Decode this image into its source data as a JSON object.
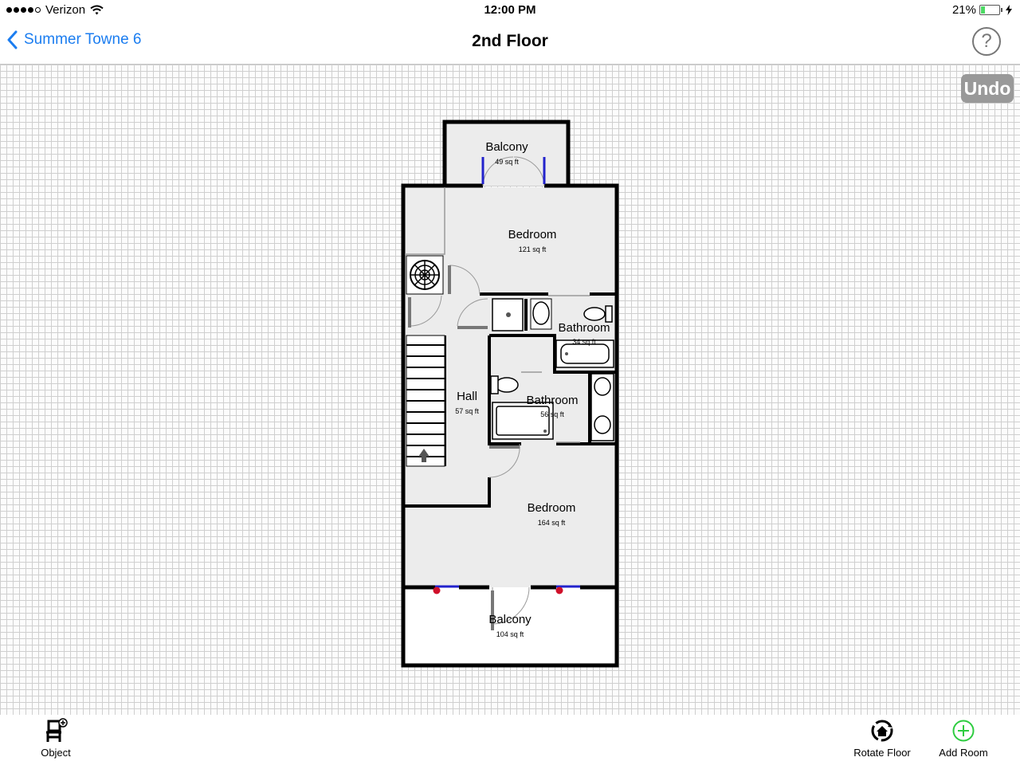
{
  "status_bar": {
    "carrier": "Verizon",
    "time": "12:00 PM",
    "battery_percent": "21%",
    "battery_level": 0.21
  },
  "nav": {
    "back_label": "Summer Towne 6",
    "title": "2nd Floor",
    "help_label": "?"
  },
  "canvas": {
    "undo_label": "Undo"
  },
  "rooms": [
    {
      "key": "balcony_top",
      "name": "Balcony",
      "area": "49 sq ft"
    },
    {
      "key": "bedroom_top",
      "name": "Bedroom",
      "area": "121 sq ft"
    },
    {
      "key": "bathroom_upper",
      "name": "Bathroom",
      "area": "34 sq ft"
    },
    {
      "key": "hall",
      "name": "Hall",
      "area": "57 sq ft"
    },
    {
      "key": "bathroom_lower",
      "name": "Bathroom",
      "area": "56 sq ft"
    },
    {
      "key": "bedroom_bottom",
      "name": "Bedroom",
      "area": "164 sq ft"
    },
    {
      "key": "balcony_bottom",
      "name": "Balcony",
      "area": "104 sq ft"
    }
  ],
  "toolbar": {
    "object_label": "Object",
    "rotate_label": "Rotate Floor",
    "add_room_label": "Add Room"
  },
  "colors": {
    "accent": "#1b7df0",
    "add_green": "#2ecc40",
    "room_fill": "#ececec",
    "wall": "#000000"
  }
}
